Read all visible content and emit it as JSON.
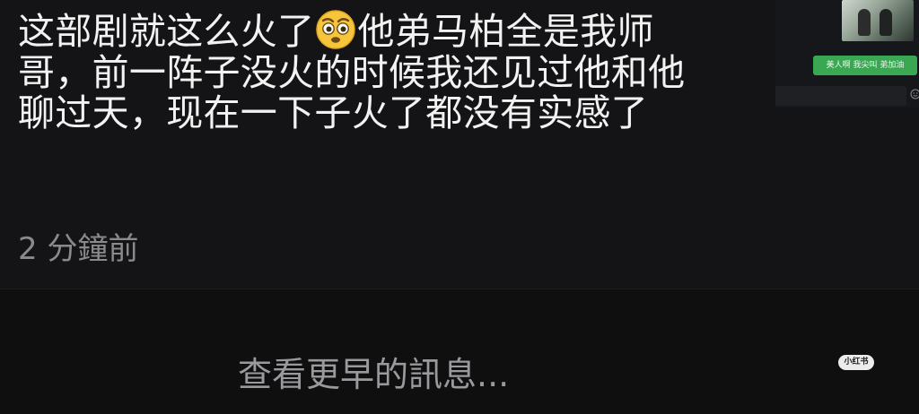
{
  "message": {
    "text_before_emoji": "这部剧就这么火了",
    "emoji": "flushed-face-emoji",
    "text_after_emoji": "他弟马柏全是我师哥，前一阵子没火的时候我还见过他和他聊过天，现在一下子火了都没有实感了",
    "time": "2 分鐘前"
  },
  "load_earlier": {
    "label": "查看更早的訊息..."
  },
  "thumbnail": {
    "bubble_text": "美人啊 我尖叫 弟加油"
  },
  "watermark": {
    "text": "小红书"
  },
  "colors": {
    "background": "#0f0f10",
    "card": "#141416",
    "text_primary": "#f2f2f2",
    "text_secondary": "#8a8a8e",
    "bubble_green": "#3aa852"
  }
}
